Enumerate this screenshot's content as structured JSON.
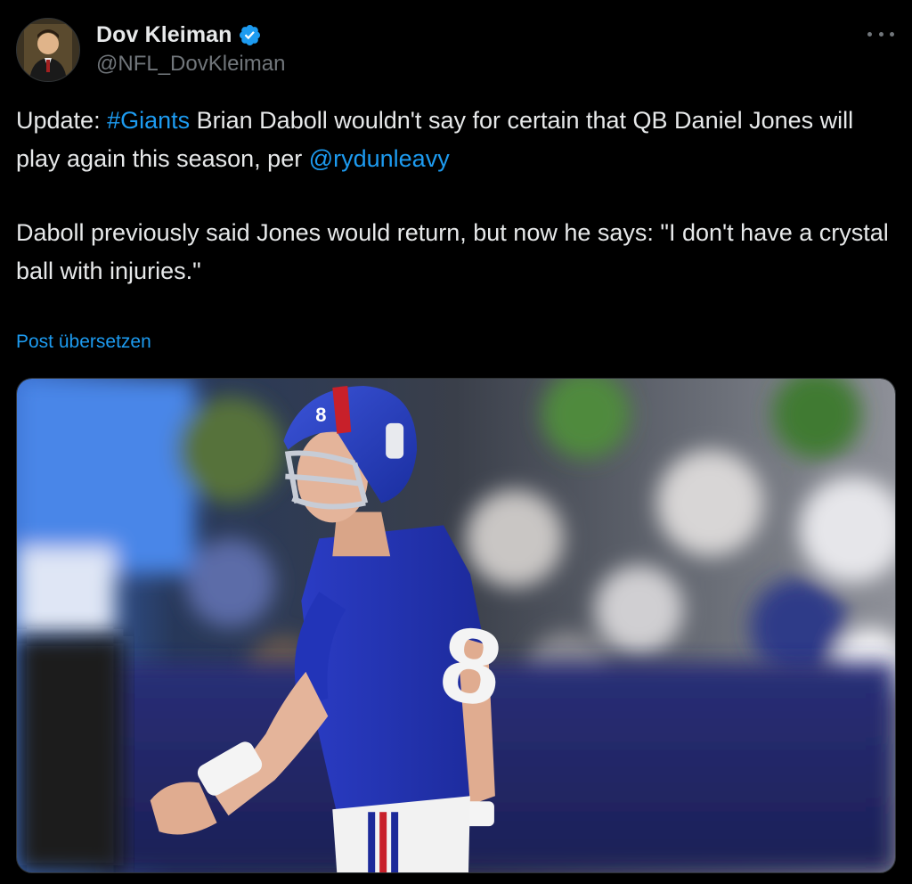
{
  "author": {
    "display_name": "Dov Kleiman",
    "handle": "@NFL_DovKleiman",
    "verified_icon": "verified-badge-icon",
    "avatar_icon": "avatar-image"
  },
  "tweet": {
    "line1_prefix": "Update: ",
    "hashtag": "#Giants",
    "line1_rest": " Brian Daboll wouldn't say for certain that QB Daniel Jones will play again this season, per ",
    "mention": "@rydunleavy",
    "paragraph2": "Daboll previously said Jones would return, but now he says: \"I don't have a crystal ball with injuries.\""
  },
  "translate_label": "Post übersetzen",
  "media": {
    "jersey_number": "8"
  },
  "colors": {
    "background": "#000000",
    "text": "#e7e9ea",
    "secondary": "#71767b",
    "accent": "#1d9bf0"
  }
}
